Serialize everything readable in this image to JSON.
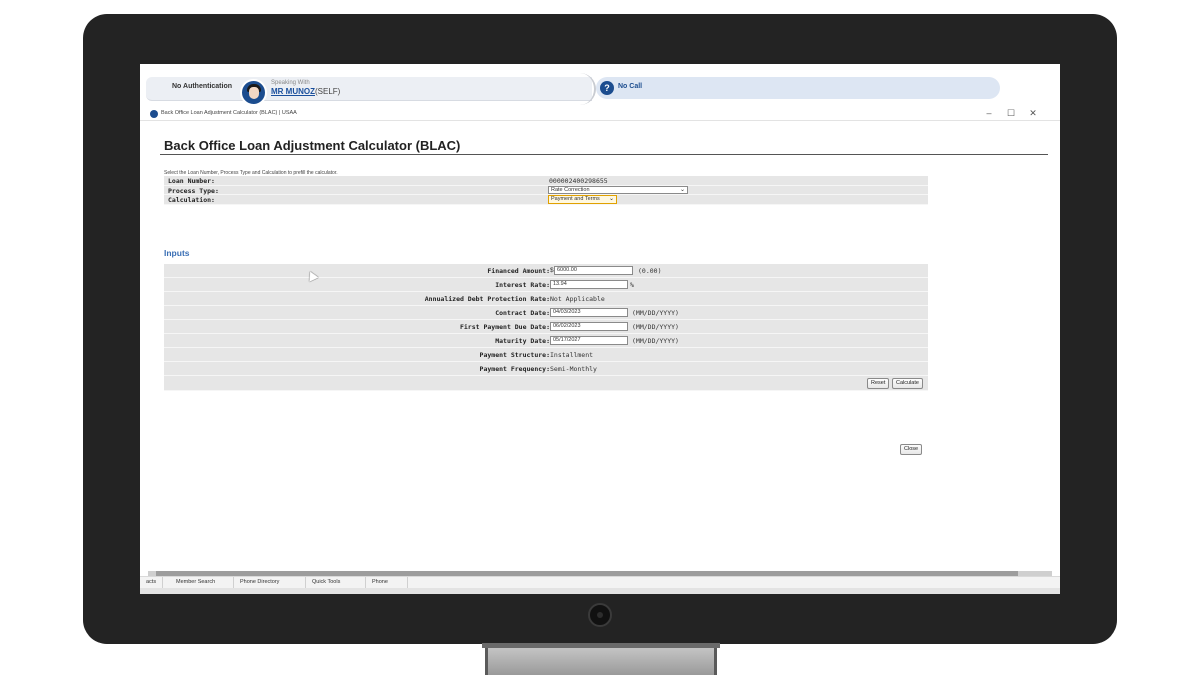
{
  "header": {
    "auth_label": "No Authentication",
    "speaking_with_label": "Speaking With",
    "member_name": "MR MUNOZ",
    "member_relation": "(SELF)",
    "call_status": "No Call",
    "call_icon": "?"
  },
  "window": {
    "title": "Back Office Loan Adjustment Calculator (BLAC) | USAA",
    "minimize": "–",
    "maximize": "☐",
    "close": "✕"
  },
  "page": {
    "title": "Back Office Loan Adjustment Calculator (BLAC)",
    "hint": "Select the Loan Number, Process Type and Calculation to prefill the calculator."
  },
  "selection": {
    "loan_number_label": "Loan Number:",
    "loan_number_value": "000002400298655",
    "process_type_label": "Process Type:",
    "process_type_value": "Rate Correction",
    "calculation_label": "Calculation:",
    "calculation_value": "Payment and Terms"
  },
  "inputs": {
    "heading": "Inputs",
    "financed_amount_label": "Financed Amount:",
    "currency_symbol": "$",
    "financed_amount_value": "6000.00",
    "financed_amount_suffix": "(0.00)",
    "interest_rate_label": "Interest Rate:",
    "interest_rate_value": "13.94",
    "interest_rate_suffix": "%",
    "adp_rate_label": "Annualized Debt Protection Rate:",
    "adp_rate_value": "Not Applicable",
    "contract_date_label": "Contract Date:",
    "contract_date_value": "04/03/2023",
    "first_payment_label": "First Payment Due Date:",
    "first_payment_value": "06/02/2023",
    "maturity_date_label": "Maturity Date:",
    "maturity_date_value": "05/17/2027",
    "date_format_hint": "(MM/DD/YYYY)",
    "payment_structure_label": "Payment Structure:",
    "payment_structure_value": "Installment",
    "payment_frequency_label": "Payment Frequency:",
    "payment_frequency_value": "Semi-Monthly",
    "reset_label": "Reset",
    "calculate_label": "Calculate"
  },
  "close_label": "Close",
  "bottom_tabs": [
    "acts",
    "Member Search",
    "Phone Directory",
    "Quick Tools",
    "Phone"
  ]
}
